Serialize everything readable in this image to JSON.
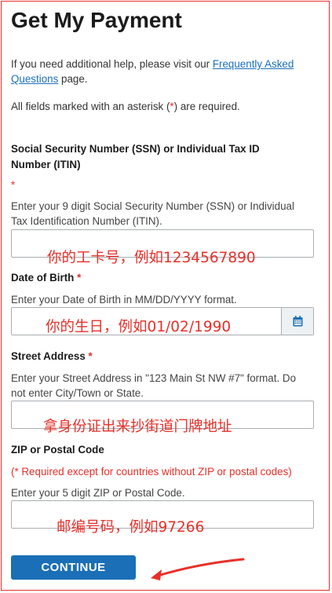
{
  "page": {
    "title": "Get My Payment",
    "help_prefix": "If you need additional help, please visit our ",
    "help_link": "Frequently Asked Questions",
    "help_suffix": " page.",
    "required_prefix": "All fields marked with an asterisk (",
    "required_asterisk": "*",
    "required_suffix": ") are required."
  },
  "fields": {
    "ssn": {
      "label": "Social Security Number (SSN) or Individual Tax ID Number (ITIN)",
      "asterisk": "*",
      "hint": "Enter your 9 digit Social Security Number (SSN) or Individual Tax Identification Number (ITIN).",
      "value": ""
    },
    "dob": {
      "label": "Date of Birth",
      "asterisk": "*",
      "hint": "Enter your Date of Birth in MM/DD/YYYY format.",
      "value": ""
    },
    "street": {
      "label": "Street Address",
      "asterisk": "*",
      "hint": "Enter your Street Address in \"123 Main St NW #7\" format. Do not enter City/Town or State.",
      "value": ""
    },
    "zip": {
      "label": "ZIP or Postal Code",
      "required_note": "(* Required except for countries without ZIP or postal codes)",
      "hint": "Enter your 5 digit ZIP or Postal Code.",
      "value": ""
    }
  },
  "annotations": {
    "ssn": "你的工卡号，例如1234567890",
    "dob": "你的生日，例如01/02/1990",
    "street": "拿身份证出来抄街道门牌地址",
    "zip": "邮编号码，例如97266"
  },
  "actions": {
    "continue_label": "CONTINUE"
  },
  "icons": {
    "calendar": "calendar-icon",
    "arrow": "red-arrow-icon"
  },
  "colors": {
    "primary": "#1a6fb6",
    "link": "#1a6fbf",
    "annotation": "#e8302a"
  }
}
